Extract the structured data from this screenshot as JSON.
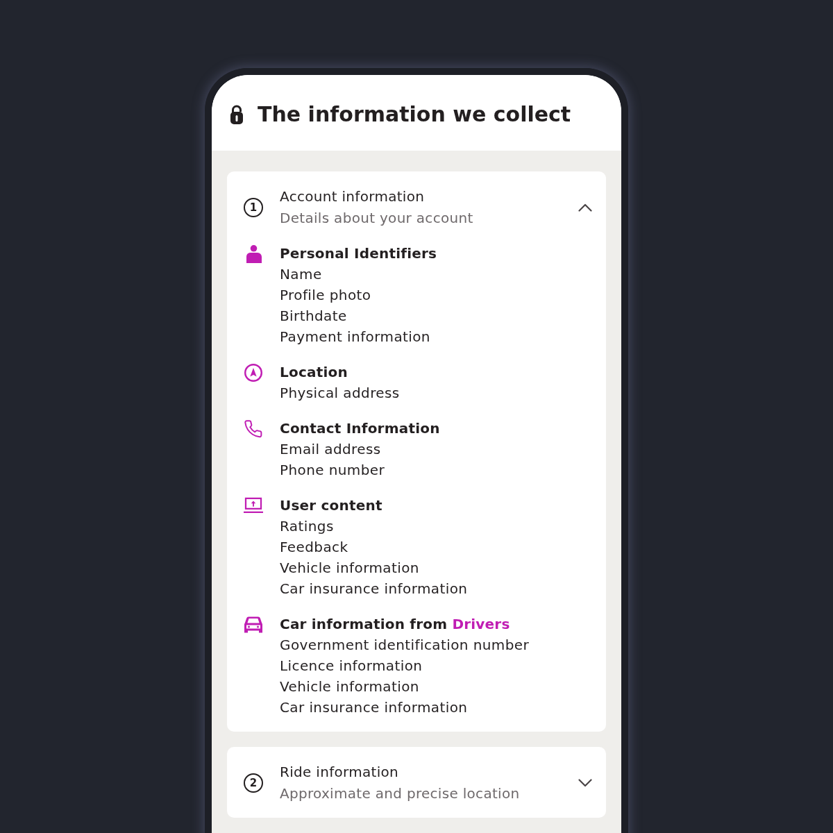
{
  "header": {
    "title": "The information we collect"
  },
  "sections": [
    {
      "number": "1",
      "title": "Account information",
      "subtitle": "Details about your account",
      "expanded": true,
      "groups": [
        {
          "kind": "person",
          "title": "Personal Identifiers",
          "items": [
            "Name",
            "Profile photo",
            "Birthdate",
            "Payment information"
          ]
        },
        {
          "kind": "location",
          "title": "Location",
          "items": [
            "Physical address"
          ]
        },
        {
          "kind": "phone",
          "title": "Contact Information",
          "items": [
            "Email address",
            "Phone number"
          ]
        },
        {
          "kind": "upload",
          "title": "User content",
          "items": [
            "Ratings",
            "Feedback",
            "Vehicle information",
            "Car insurance information"
          ]
        },
        {
          "kind": "car",
          "title": "Car information from",
          "link": "Drivers",
          "items": [
            "Government identification number",
            "Licence information",
            "Vehicle information",
            "Car insurance information"
          ]
        }
      ]
    },
    {
      "number": "2",
      "title": "Ride information",
      "subtitle": "Approximate and precise location",
      "expanded": false
    }
  ]
}
